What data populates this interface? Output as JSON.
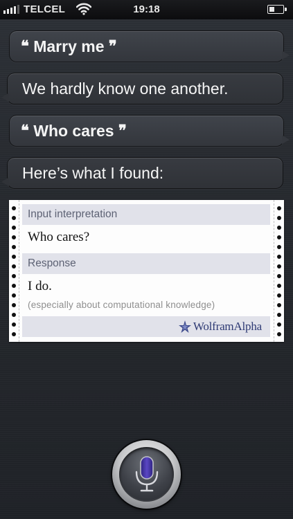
{
  "status_bar": {
    "carrier": "TELCEL",
    "time": "19:18",
    "signal_bars": 4,
    "battery_level": 0.4
  },
  "conversation": {
    "messages": [
      {
        "speaker": "user",
        "text": "Marry me"
      },
      {
        "speaker": "siri",
        "text": "We hardly know one another."
      },
      {
        "speaker": "user",
        "text": "Who cares"
      },
      {
        "speaker": "siri",
        "text": "Here’s what I found:"
      }
    ],
    "open_quote": "❝",
    "close_quote": "❞"
  },
  "wolfram_card": {
    "input_header": "Input interpretation",
    "input_value": "Who cares?",
    "response_header": "Response",
    "response_value": "I do.",
    "response_note": "(especially about computational knowledge)",
    "brand": "WolframAlpha"
  },
  "icons": {
    "signal": "signal-bars-icon",
    "wifi": "wifi-icon",
    "battery": "battery-icon",
    "microphone": "microphone-icon",
    "brand_logo": "wolframalpha-star-icon"
  },
  "colors": {
    "bubble_text": "#f4f4f4",
    "pod_header_bg": "#e1e2ea",
    "pod_header_text": "#5d6274",
    "brand_text": "#2e3a74",
    "mic_accent": "#4b3aa8"
  }
}
